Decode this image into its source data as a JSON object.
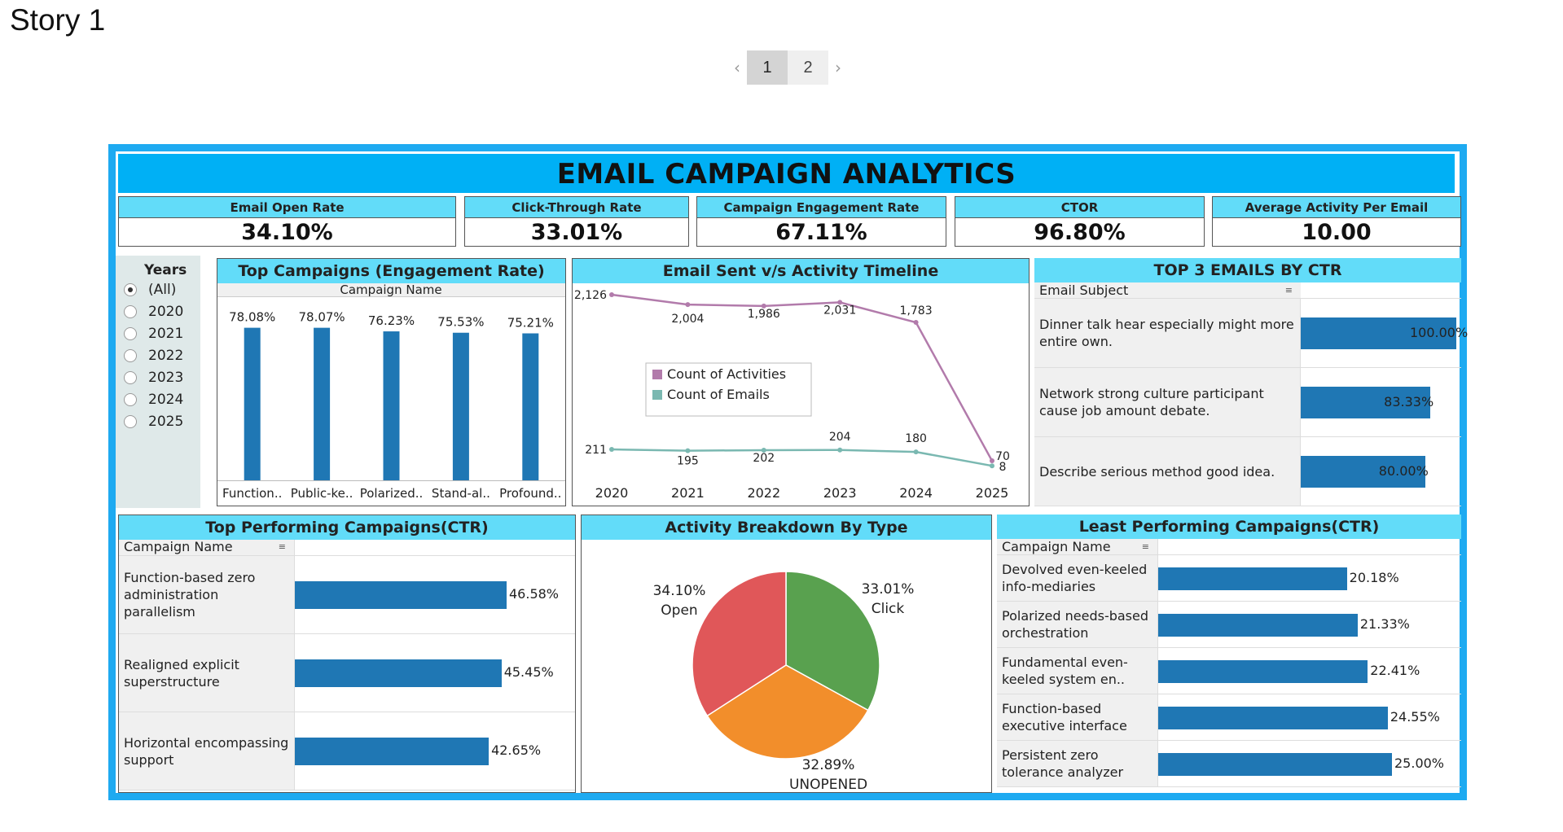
{
  "story": {
    "title": "Story 1"
  },
  "pager": {
    "pages": [
      "1",
      "2"
    ],
    "active": "1",
    "prev": "‹",
    "next": "›"
  },
  "dashboard": {
    "title": "EMAIL CAMPAIGN ANALYTICS",
    "kpis": [
      {
        "label": "Email Open Rate",
        "value": "34.10%"
      },
      {
        "label": "Click-Through Rate",
        "value": "33.01%"
      },
      {
        "label": "Campaign Engagement Rate",
        "value": "67.11%"
      },
      {
        "label": "CTOR",
        "value": "96.80%"
      },
      {
        "label": "Average Activity Per Email",
        "value": "10.00"
      }
    ],
    "years_filter": {
      "title": "Years",
      "options": [
        "(All)",
        "2020",
        "2021",
        "2022",
        "2023",
        "2024",
        "2025"
      ],
      "selected": "(All)"
    },
    "top_campaigns_engagement": {
      "title": "Top Campaigns (Engagement Rate)",
      "column_header": "Campaign Name"
    },
    "timeline": {
      "title": "Email Sent v/s Activity Timeline",
      "legend": [
        "Count of Activities",
        "Count of Emails"
      ]
    },
    "top3_ctr": {
      "title": "TOP 3 EMAILS BY CTR",
      "column_header": "Email Subject",
      "rows": [
        {
          "label": "Dinner talk hear especially might more entire own.",
          "value": 100.0,
          "text": "100.00%"
        },
        {
          "label": "Network strong culture participant cause job amount debate.",
          "value": 83.33,
          "text": "83.33%"
        },
        {
          "label": "Describe serious method good idea.",
          "value": 80.0,
          "text": "80.00%"
        }
      ]
    },
    "top_performing_ctr": {
      "title": "Top Performing Campaigns(CTR)",
      "column_header": "Campaign Name",
      "rows": [
        {
          "label": "Function-based zero administration parallelism",
          "value": 46.58,
          "text": "46.58%"
        },
        {
          "label": "Realigned explicit superstructure",
          "value": 45.45,
          "text": "45.45%"
        },
        {
          "label": "Horizontal encompassing support",
          "value": 42.65,
          "text": "42.65%"
        }
      ]
    },
    "activity_breakdown": {
      "title": "Activity Breakdown By Type"
    },
    "least_performing_ctr": {
      "title": "Least Performing Campaigns(CTR)",
      "column_header": "Campaign Name",
      "rows": [
        {
          "label": "Devolved even-keeled info-mediaries",
          "value": 20.18,
          "text": "20.18%"
        },
        {
          "label": "Polarized needs-based orchestration",
          "value": 21.33,
          "text": "21.33%"
        },
        {
          "label": "Fundamental even-keeled system en..",
          "value": 22.41,
          "text": "22.41%"
        },
        {
          "label": "Function-based executive interface",
          "value": 24.55,
          "text": "24.55%"
        },
        {
          "label": "Persistent zero tolerance analyzer",
          "value": 25.0,
          "text": "25.00%"
        }
      ]
    },
    "colors": {
      "frame": "#1eaaf1",
      "title_bg": "#00b0f5",
      "header_bg": "#62dcf9",
      "bar": "#1f77b4",
      "activities_line": "#b27bab",
      "emails_line": "#7ab8b1",
      "pie_open": "#e05759",
      "pie_click": "#59a14f",
      "pie_unopened": "#f28e2b"
    }
  },
  "chart_data": [
    {
      "type": "bar",
      "title": "Top Campaigns (Engagement Rate)",
      "xlabel": "Campaign Name",
      "categories": [
        "Function..",
        "Public-ke..",
        "Polarized..",
        "Stand-al..",
        "Profound.."
      ],
      "values": [
        78.08,
        78.07,
        76.23,
        75.53,
        75.21
      ],
      "labels": [
        "78.08%",
        "78.07%",
        "76.23%",
        "75.53%",
        "75.21%"
      ]
    },
    {
      "type": "line",
      "title": "Email Sent v/s Activity Timeline",
      "x": [
        "2020",
        "2021",
        "2022",
        "2023",
        "2024",
        "2025"
      ],
      "series": [
        {
          "name": "Count of Activities",
          "values": [
            2126,
            2004,
            1986,
            2031,
            1783,
            70
          ],
          "labels": [
            "2,126",
            "2,004",
            "1,986",
            "2,031",
            "1,783",
            "70"
          ]
        },
        {
          "name": "Count of Emails",
          "values": [
            211,
            195,
            202,
            204,
            180,
            8
          ],
          "labels": [
            "211",
            "195",
            "202",
            "204",
            "180",
            "8"
          ]
        }
      ],
      "legend": "center"
    },
    {
      "type": "pie",
      "title": "Activity Breakdown By Type",
      "slices": [
        {
          "label": "Click",
          "value": 33.01,
          "text": "33.01%"
        },
        {
          "label": "UNOPENED",
          "value": 32.89,
          "text": "32.89%"
        },
        {
          "label": "Open",
          "value": 34.1,
          "text": "34.10%"
        }
      ]
    }
  ]
}
